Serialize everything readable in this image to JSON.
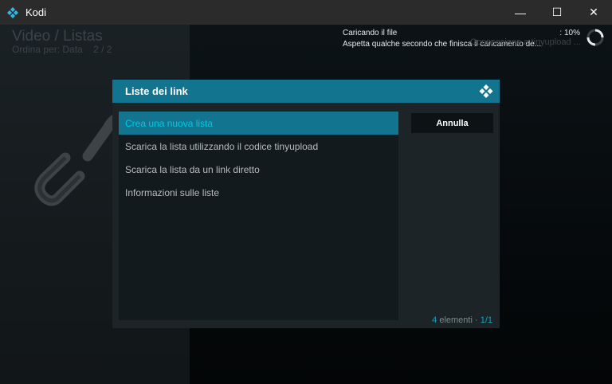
{
  "window": {
    "title": "Kodi",
    "minimize_label": "—",
    "maximize_label": "☐",
    "close_label": "✕"
  },
  "header": {
    "title": "Video / Listas",
    "sort": "Ordina per: Data",
    "page": "2 / 2"
  },
  "progress": {
    "line1": "Caricando il file",
    "percent": ": 10%",
    "line2": "Aspetta qualche secondo che finisca il caricamento de...",
    "ghost": "Connessione a tinyupload ..."
  },
  "dialog": {
    "title": "Liste dei link",
    "items": [
      {
        "label": "Crea una nuova lista"
      },
      {
        "label": "Scarica la lista utilizzando il codice tinyupload"
      },
      {
        "label": "Scarica la lista da un link diretto"
      },
      {
        "label": "Informazioni sulle liste"
      }
    ],
    "cancel_label": "Annulla",
    "count": "4",
    "count_label": "elementi",
    "dot": "·",
    "page": "1/1"
  },
  "colors": {
    "accent": "#12748f",
    "selected_text": "#00c8e4",
    "titlebar": "#2b2b2b"
  },
  "icons": [
    "kodi-icon",
    "chain-icon",
    "spinner-icon",
    "kodi-logo-icon"
  ]
}
